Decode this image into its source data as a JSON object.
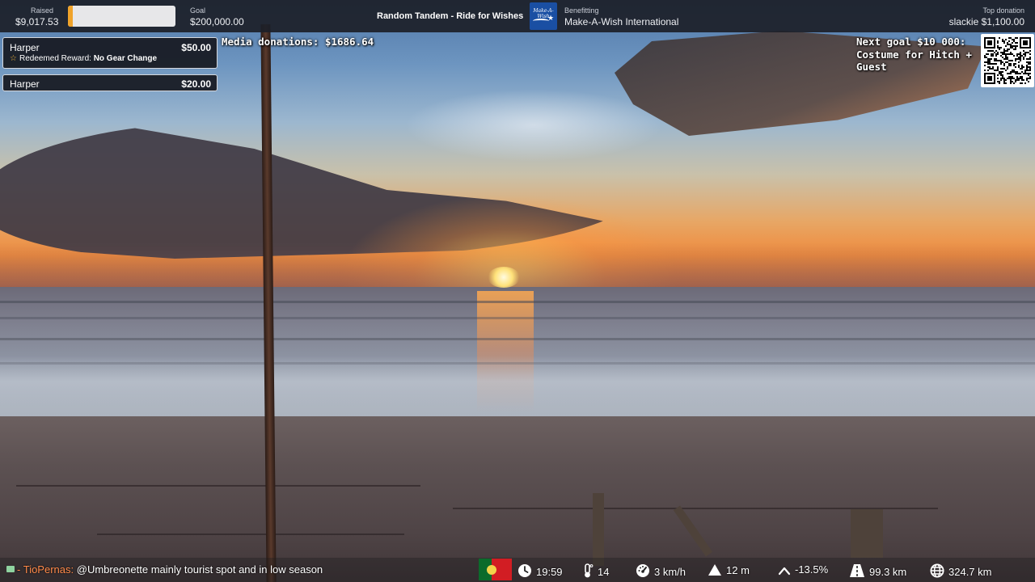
{
  "topbar": {
    "raised_label": "Raised",
    "raised_value": "$9,017.53",
    "progress_fraction": 0.045,
    "goal_label": "Goal",
    "goal_value": "$200,000.00",
    "event_title": "Random Tandem - Ride for Wishes",
    "charity_logo_text": "Make-A-Wish",
    "benefitting_label": "Benefitting",
    "benefitting_value": "Make-A-Wish International",
    "top_donation_label": "Top donation",
    "top_donation_value": "slackie $1,100.00"
  },
  "donations": [
    {
      "name": "Harper",
      "amount": "$50.00",
      "reward_prefix": "Redeemed Reward:",
      "reward_name": "No Gear Change"
    },
    {
      "name": "Harper",
      "amount": "$20.00"
    }
  ],
  "overlay": {
    "media_donations": "Media donations: $1686.64",
    "next_goal_line1": "Next goal $10 000:",
    "next_goal_line2": "Costume for Hitch +",
    "next_goal_line3": "Guest"
  },
  "chat": {
    "separator": "-",
    "user": "TioPernas:",
    "message": "@Umbreonette mainly tourist spot and in low season"
  },
  "stats": {
    "time": "19:59",
    "temperature": "14",
    "speed": "3 km/h",
    "altitude": "12 m",
    "grade": "-13.5%",
    "trip_distance": "99.3 km",
    "total_distance": "324.7 km"
  },
  "icons": {
    "clock": "clock-icon",
    "temperature": "thermometer-icon",
    "speed": "speedometer-icon",
    "altitude": "mountain-icon",
    "grade": "chevron-up-icon",
    "trip_distance": "road-icon",
    "total_distance": "globe-icon"
  },
  "colors": {
    "progress_fill": "#f0a32a",
    "chat_user": "#ff8a4a",
    "flag_green": "#0b6b2b",
    "flag_red": "#d21d23"
  }
}
